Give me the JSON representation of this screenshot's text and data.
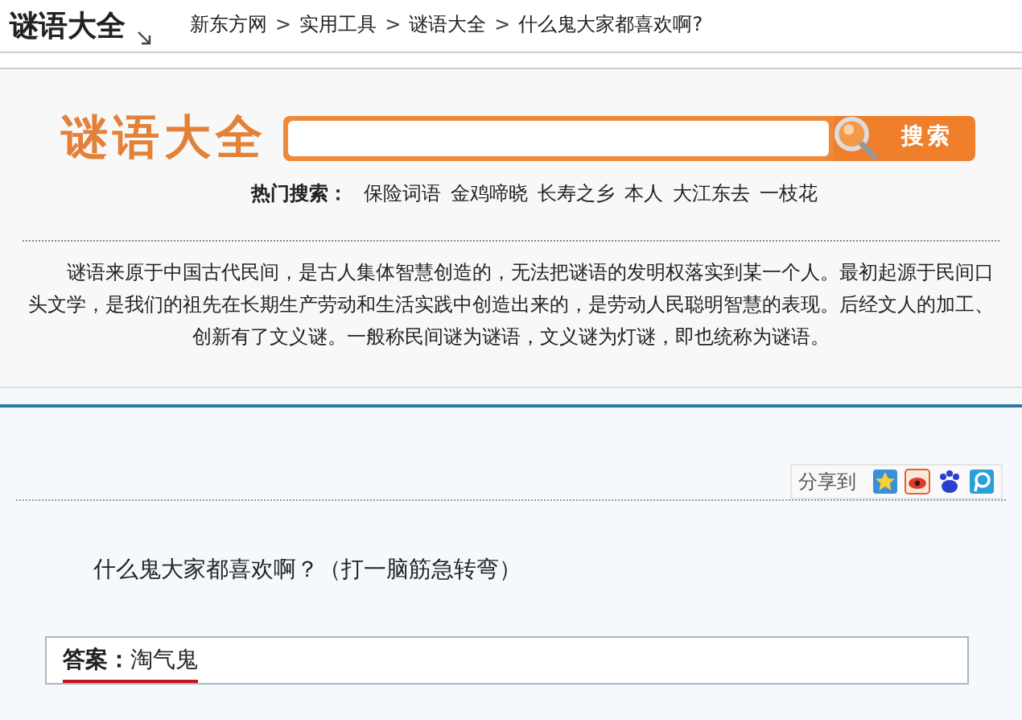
{
  "header": {
    "site_title": "谜语大全",
    "breadcrumb": [
      {
        "kind": "link",
        "label": "新东方网"
      },
      {
        "kind": "separator",
        "label": ">"
      },
      {
        "kind": "link",
        "label": "实用工具"
      },
      {
        "kind": "separator",
        "label": ">"
      },
      {
        "kind": "link",
        "label": "谜语大全"
      },
      {
        "kind": "separator",
        "label": ">"
      },
      {
        "kind": "current",
        "label": "什么鬼大家都喜欢啊?"
      }
    ]
  },
  "search": {
    "logo": "谜语大全",
    "button": "搜索",
    "hot_label": "热门搜索：",
    "hot_terms": [
      "保险词语",
      "金鸡啼晓",
      "长寿之乡",
      "本人",
      "大江东去",
      "一枝花"
    ]
  },
  "intro": "谜语来原于中国古代民间，是古人集体智慧创造的，无法把谜语的发明权落实到某一个人。最初起源于民间口头文学，是我们的祖先在长期生产劳动和生活实践中创造出来的，是劳动人民聪明智慧的表现。后经文人的加工、创新有了文义谜。一般称民间谜为谜语，文义谜为灯谜，即也统称为谜语。",
  "share": {
    "label": "分享到",
    "services": [
      {
        "kind": "star"
      },
      {
        "kind": "eye"
      },
      {
        "kind": "paw"
      },
      {
        "kind": "bubble"
      }
    ]
  },
  "question": "什么鬼大家都喜欢啊？（打一脑筋急转弯）",
  "answer": {
    "label": "答案：",
    "value": "淘气鬼"
  }
}
